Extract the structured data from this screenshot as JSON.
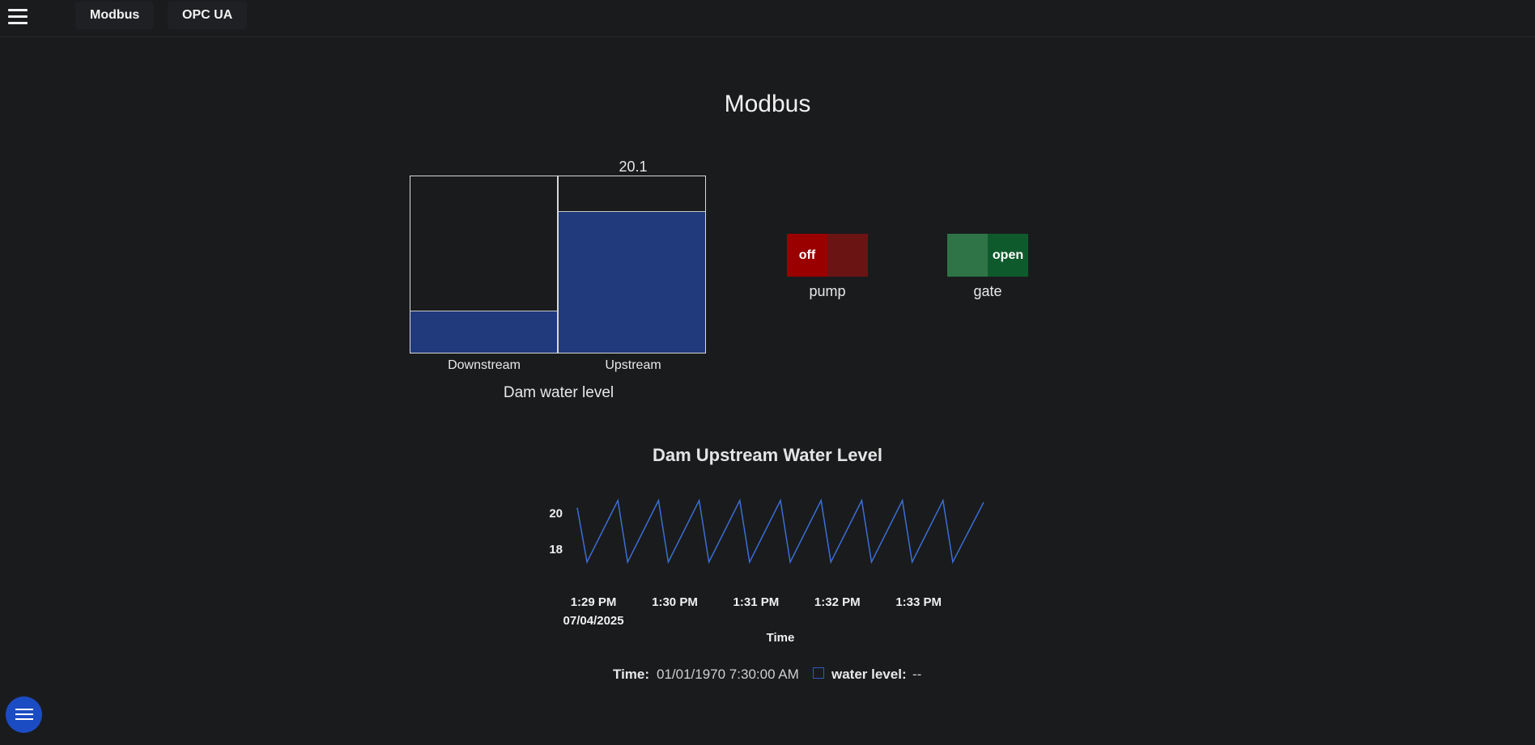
{
  "nav": {
    "tabs": [
      {
        "label": "Modbus"
      },
      {
        "label": "OPC UA"
      }
    ]
  },
  "page": {
    "title": "Modbus"
  },
  "tank_gauge": {
    "caption": "Dam water level",
    "max": 25,
    "tanks": [
      {
        "label": "Downstream",
        "value": 6,
        "value_text": ""
      },
      {
        "label": "Upstream",
        "value": 20.1,
        "value_text": "20.1"
      }
    ],
    "fill_color": "#203a7c"
  },
  "switches": [
    {
      "label": "pump",
      "state_text": "off",
      "state": "off",
      "on_color": "#9b0000"
    },
    {
      "label": "gate",
      "state_text": "open",
      "state": "on",
      "on_color": "#0f5a2c"
    }
  ],
  "chart_data": {
    "type": "line",
    "title": "Dam Upstream Water Level",
    "xlabel": "Time",
    "ylabel": "",
    "x_ticks": [
      "1:29 PM",
      "1:30 PM",
      "1:31 PM",
      "1:32 PM",
      "1:33 PM"
    ],
    "x_first_date": "07/04/2025",
    "y_ticks": [
      20,
      18
    ],
    "ylim": [
      16.8,
      21
    ],
    "xlim_minutes": [
      -0.2,
      4.8
    ],
    "series": [
      {
        "name": "water level",
        "color": "#3a6fd6",
        "x_minutes": [
          -0.2,
          -0.08,
          0.3,
          0.42,
          0.8,
          0.92,
          1.3,
          1.42,
          1.8,
          1.92,
          2.3,
          2.42,
          2.8,
          2.92,
          3.3,
          3.42,
          3.8,
          3.92,
          4.3,
          4.42,
          4.8
        ],
        "values": [
          20.3,
          17.3,
          20.7,
          17.3,
          20.7,
          17.3,
          20.7,
          17.3,
          20.7,
          17.3,
          20.7,
          17.3,
          20.7,
          17.3,
          20.7,
          17.3,
          20.7,
          17.3,
          20.7,
          17.3,
          20.6
        ]
      }
    ]
  },
  "legend": {
    "time_label": "Time:",
    "time_value": "01/01/1970 7:30:00 AM",
    "series_label": "water level:",
    "series_value": "--"
  }
}
